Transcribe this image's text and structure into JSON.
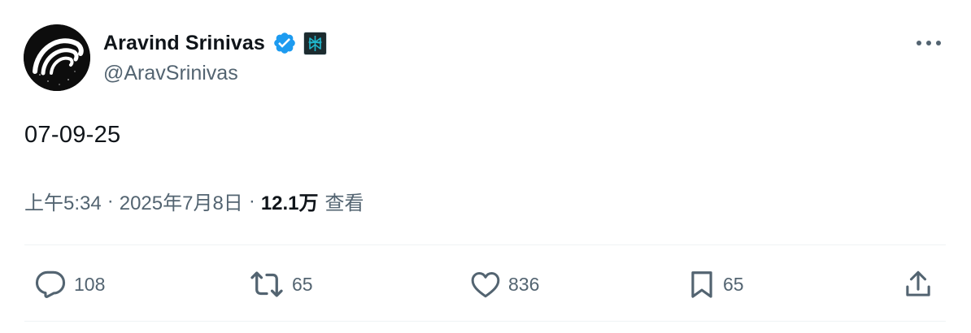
{
  "author": {
    "display_name": "Aravind Srinivas",
    "handle": "@AravSrinivas",
    "verified": true,
    "avatar_icon": "wave-logo-avatar",
    "affiliate_badge_icon": "perplexity-logo-icon"
  },
  "tweet": {
    "text": "07-09-25"
  },
  "meta": {
    "time": "上午5:34",
    "separator": "·",
    "date": "2025年7月8日",
    "views_count": "12.1万",
    "views_label": "查看"
  },
  "actions": {
    "replies": "108",
    "retweets": "65",
    "likes": "836",
    "bookmarks": "65"
  },
  "colors": {
    "text_primary": "#0f1419",
    "text_secondary": "#536471",
    "verified_blue": "#1d9bf0",
    "divider": "#eff3f4"
  }
}
